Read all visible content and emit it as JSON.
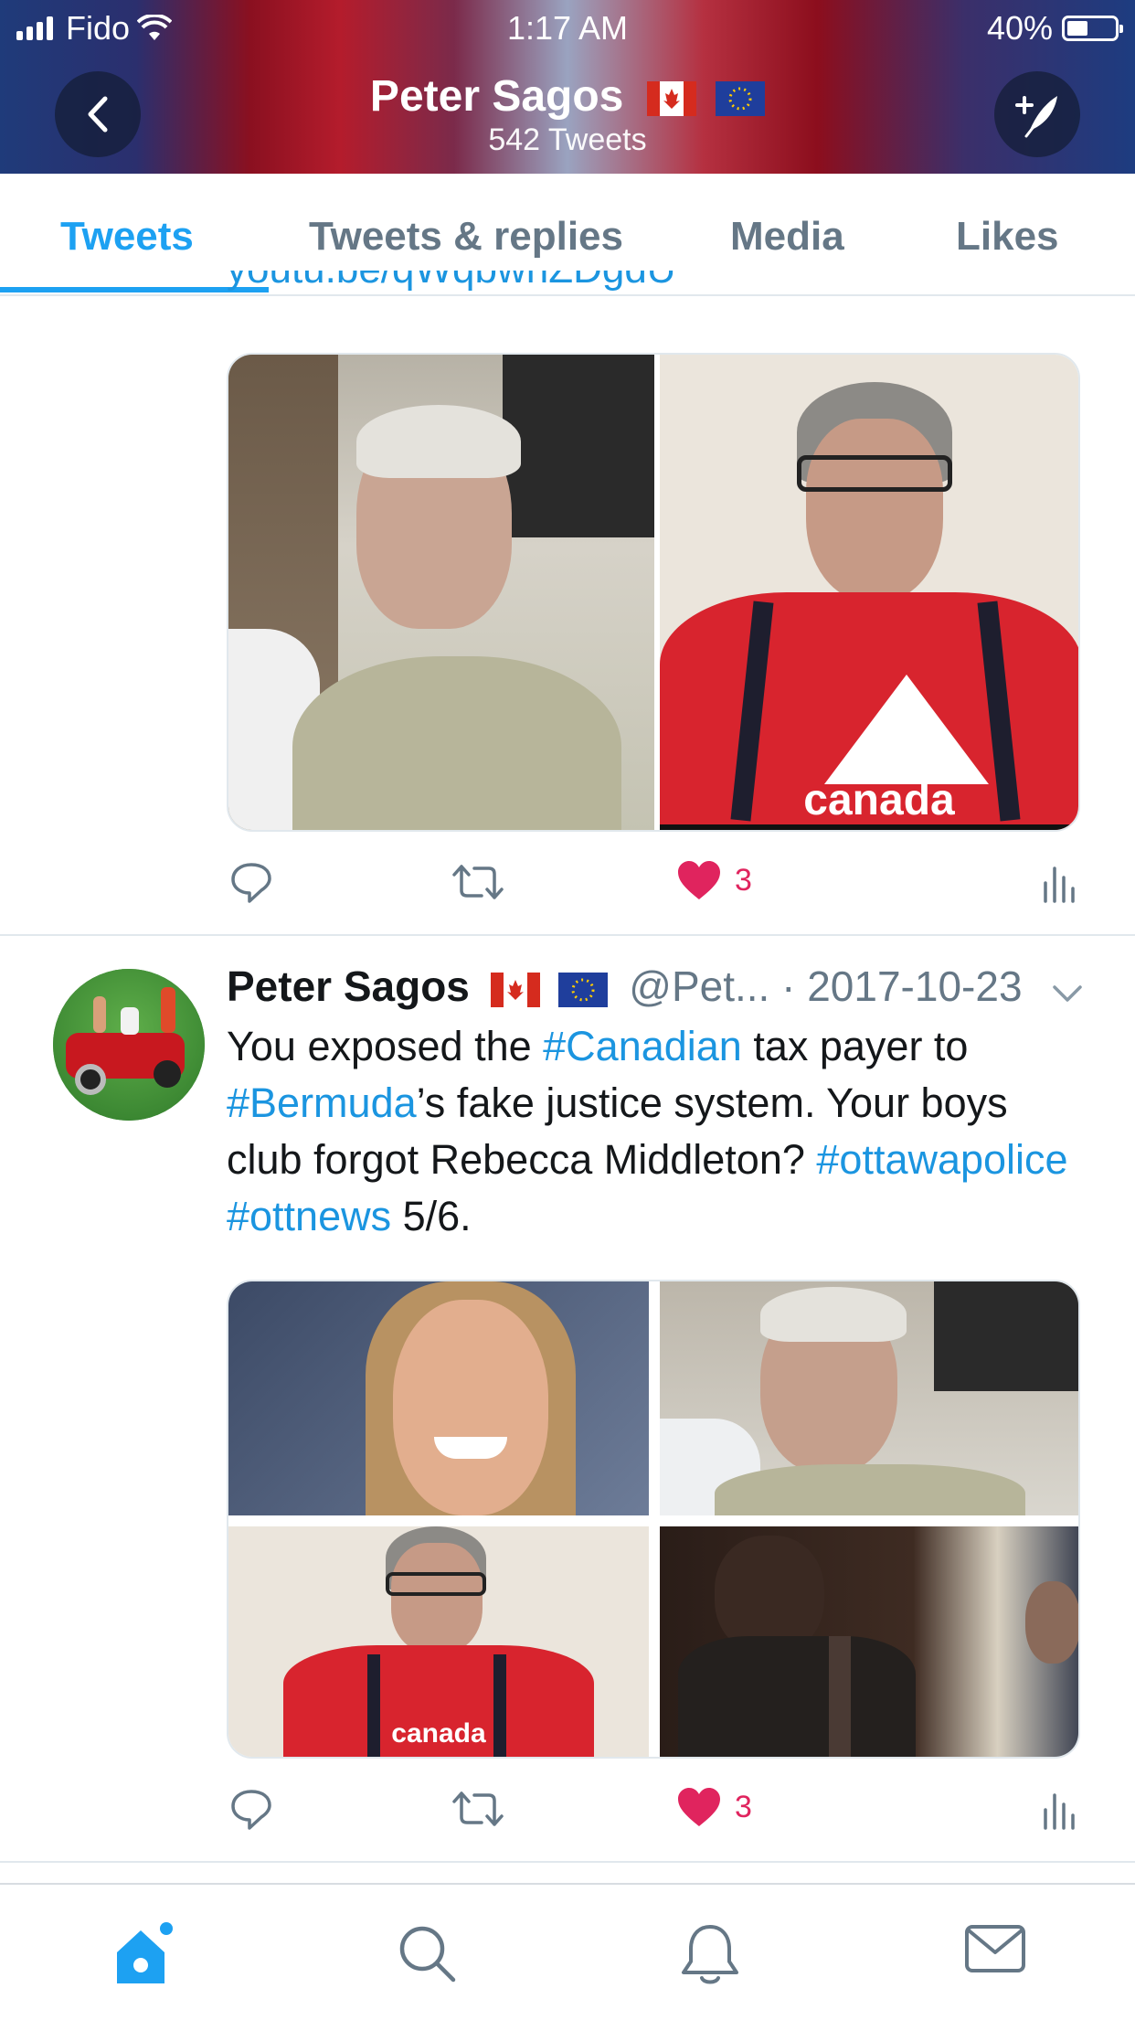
{
  "status_bar": {
    "carrier": "Fido",
    "time": "1:17 AM",
    "battery": "40%"
  },
  "header": {
    "title": "Peter Sagos",
    "subtitle": "542 Tweets",
    "back_icon": "chevron-left-icon",
    "compose_icon": "compose-tweet-icon"
  },
  "tabs": [
    {
      "label": "Tweets",
      "active": true
    },
    {
      "label": "Tweets & replies",
      "active": false
    },
    {
      "label": "Media",
      "active": false
    },
    {
      "label": "Likes",
      "active": false
    }
  ],
  "tweet1": {
    "link_fragment": "youtu.be/qWqbwnZDgdU",
    "likes": "3"
  },
  "tweet2": {
    "name": "Peter Sagos",
    "handle": "@Pet...",
    "date": "· 2017-10-23",
    "text": {
      "p1": "You exposed the ",
      "t1": "#Canadian",
      "p2": " tax payer to ",
      "t2": "#Bermuda",
      "p3": "’s fake justice system. Your boys club forgot Rebecca Middleton? ",
      "t3": "#ottawapolice",
      "p4": " ",
      "t4": "#ottnews",
      "p5": " 5/6."
    },
    "likes": "3"
  },
  "colors": {
    "accent": "#1da1f2",
    "like": "#e0245e",
    "muted": "#657786"
  },
  "bottom_nav": [
    "home-icon",
    "search-icon",
    "notifications-icon",
    "messages-icon"
  ]
}
